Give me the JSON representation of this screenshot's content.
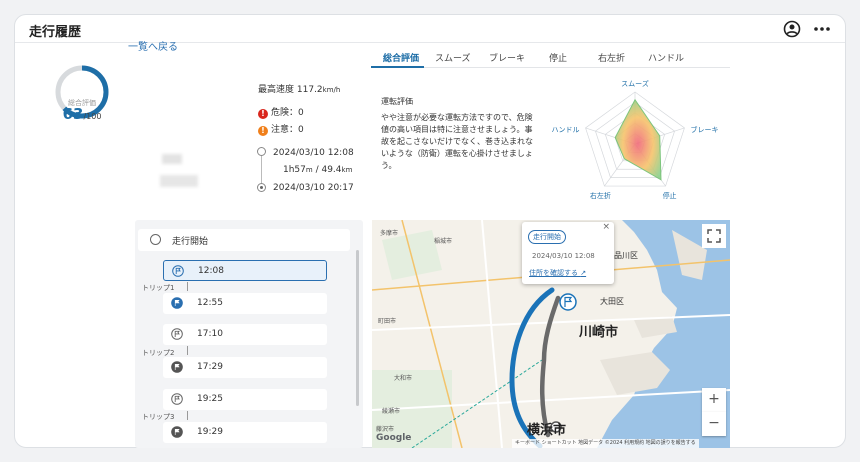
{
  "header": {
    "title": "走行履歴"
  },
  "back_link": "一覧へ戻る",
  "summary": {
    "gauge_label": "総合評価",
    "score": "63",
    "score_max": "/100",
    "max_speed_label": "最高速度",
    "max_speed_value": "117.2",
    "max_speed_unit": "km/h",
    "danger_label": "危険：0",
    "caution_label": "注意：0",
    "start_time": "2024/03/10 12:08",
    "duration": "1h57",
    "duration_unit": "m",
    "distance": " / 49.4",
    "distance_unit": "km",
    "end_time": "2024/03/10 20:17"
  },
  "tabs": [
    {
      "label": "総合評価"
    },
    {
      "label": "スムーズ"
    },
    {
      "label": "ブレーキ"
    },
    {
      "label": "停止"
    },
    {
      "label": "右左折"
    },
    {
      "label": "ハンドル"
    }
  ],
  "evaluation": {
    "title": "運転評価",
    "text": "やや注意が必要な運転方法ですので、危険値の高い項目は特に注意させましょう。事故を起こさないだけでなく、巻き込まれないような（防衛）運転を心掛けさせましょう。"
  },
  "radar": {
    "axes": [
      "スムーズ",
      "ブレーキ",
      "停止",
      "右左折",
      "ハンドル"
    ],
    "values": [
      0.85,
      0.5,
      0.85,
      0.35,
      0.4
    ]
  },
  "trip_list": {
    "start_label": "走行開始",
    "times": [
      "12:08",
      "12:55",
      "17:10",
      "17:29",
      "19:25",
      "19:29"
    ],
    "trip_labels": [
      "トリップ1",
      "トリップ2",
      "トリップ3"
    ]
  },
  "map": {
    "popup_badge": "走行開始",
    "popup_time": "2024/03/10 12:08",
    "popup_link": "住所を確認する",
    "popup_close": "×",
    "city_kawasaki": "川崎市",
    "city_yokohama": "横浜市",
    "ward_ota": "大田区",
    "ward_shinagawa": "品川区",
    "labels": [
      "多摩市",
      "稲城市",
      "町田市",
      "大和市",
      "藤沢市",
      "綾瀬市"
    ],
    "zoom_in": "+",
    "zoom_out": "−",
    "google": "Google",
    "attribution": "キーボード ショートカット  地図データ ©2024  利用規約  地図の誤りを報告する"
  },
  "colors": {
    "accent": "#1e6ea7",
    "danger": "#d9261c",
    "caution": "#f07f1a",
    "route_blue": "#1a73b8",
    "route_gray": "#6a6a6a"
  }
}
